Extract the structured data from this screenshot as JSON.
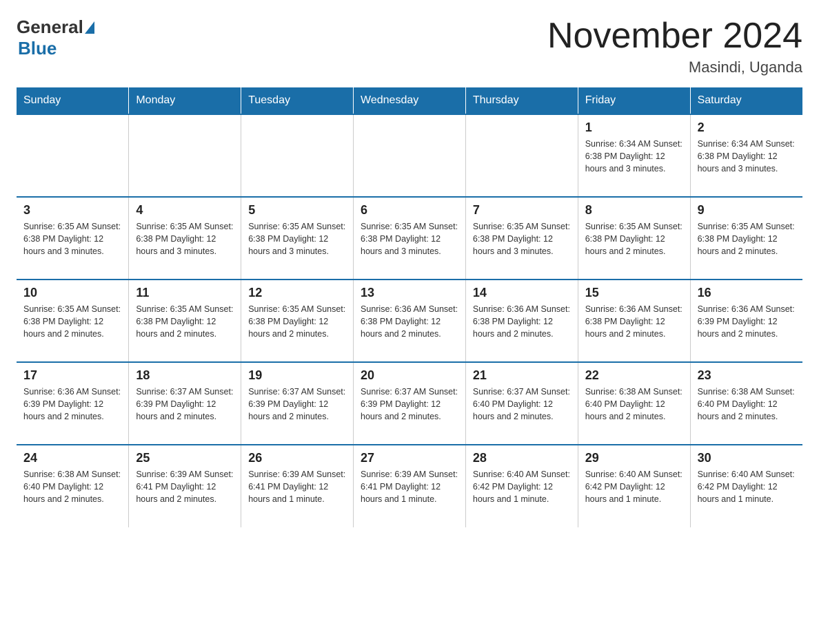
{
  "header": {
    "logo_general": "General",
    "logo_blue": "Blue",
    "title": "November 2024",
    "subtitle": "Masindi, Uganda"
  },
  "days_of_week": [
    "Sunday",
    "Monday",
    "Tuesday",
    "Wednesday",
    "Thursday",
    "Friday",
    "Saturday"
  ],
  "weeks": [
    [
      {
        "day": "",
        "info": ""
      },
      {
        "day": "",
        "info": ""
      },
      {
        "day": "",
        "info": ""
      },
      {
        "day": "",
        "info": ""
      },
      {
        "day": "",
        "info": ""
      },
      {
        "day": "1",
        "info": "Sunrise: 6:34 AM\nSunset: 6:38 PM\nDaylight: 12 hours and 3 minutes."
      },
      {
        "day": "2",
        "info": "Sunrise: 6:34 AM\nSunset: 6:38 PM\nDaylight: 12 hours and 3 minutes."
      }
    ],
    [
      {
        "day": "3",
        "info": "Sunrise: 6:35 AM\nSunset: 6:38 PM\nDaylight: 12 hours and 3 minutes."
      },
      {
        "day": "4",
        "info": "Sunrise: 6:35 AM\nSunset: 6:38 PM\nDaylight: 12 hours and 3 minutes."
      },
      {
        "day": "5",
        "info": "Sunrise: 6:35 AM\nSunset: 6:38 PM\nDaylight: 12 hours and 3 minutes."
      },
      {
        "day": "6",
        "info": "Sunrise: 6:35 AM\nSunset: 6:38 PM\nDaylight: 12 hours and 3 minutes."
      },
      {
        "day": "7",
        "info": "Sunrise: 6:35 AM\nSunset: 6:38 PM\nDaylight: 12 hours and 3 minutes."
      },
      {
        "day": "8",
        "info": "Sunrise: 6:35 AM\nSunset: 6:38 PM\nDaylight: 12 hours and 2 minutes."
      },
      {
        "day": "9",
        "info": "Sunrise: 6:35 AM\nSunset: 6:38 PM\nDaylight: 12 hours and 2 minutes."
      }
    ],
    [
      {
        "day": "10",
        "info": "Sunrise: 6:35 AM\nSunset: 6:38 PM\nDaylight: 12 hours and 2 minutes."
      },
      {
        "day": "11",
        "info": "Sunrise: 6:35 AM\nSunset: 6:38 PM\nDaylight: 12 hours and 2 minutes."
      },
      {
        "day": "12",
        "info": "Sunrise: 6:35 AM\nSunset: 6:38 PM\nDaylight: 12 hours and 2 minutes."
      },
      {
        "day": "13",
        "info": "Sunrise: 6:36 AM\nSunset: 6:38 PM\nDaylight: 12 hours and 2 minutes."
      },
      {
        "day": "14",
        "info": "Sunrise: 6:36 AM\nSunset: 6:38 PM\nDaylight: 12 hours and 2 minutes."
      },
      {
        "day": "15",
        "info": "Sunrise: 6:36 AM\nSunset: 6:38 PM\nDaylight: 12 hours and 2 minutes."
      },
      {
        "day": "16",
        "info": "Sunrise: 6:36 AM\nSunset: 6:39 PM\nDaylight: 12 hours and 2 minutes."
      }
    ],
    [
      {
        "day": "17",
        "info": "Sunrise: 6:36 AM\nSunset: 6:39 PM\nDaylight: 12 hours and 2 minutes."
      },
      {
        "day": "18",
        "info": "Sunrise: 6:37 AM\nSunset: 6:39 PM\nDaylight: 12 hours and 2 minutes."
      },
      {
        "day": "19",
        "info": "Sunrise: 6:37 AM\nSunset: 6:39 PM\nDaylight: 12 hours and 2 minutes."
      },
      {
        "day": "20",
        "info": "Sunrise: 6:37 AM\nSunset: 6:39 PM\nDaylight: 12 hours and 2 minutes."
      },
      {
        "day": "21",
        "info": "Sunrise: 6:37 AM\nSunset: 6:40 PM\nDaylight: 12 hours and 2 minutes."
      },
      {
        "day": "22",
        "info": "Sunrise: 6:38 AM\nSunset: 6:40 PM\nDaylight: 12 hours and 2 minutes."
      },
      {
        "day": "23",
        "info": "Sunrise: 6:38 AM\nSunset: 6:40 PM\nDaylight: 12 hours and 2 minutes."
      }
    ],
    [
      {
        "day": "24",
        "info": "Sunrise: 6:38 AM\nSunset: 6:40 PM\nDaylight: 12 hours and 2 minutes."
      },
      {
        "day": "25",
        "info": "Sunrise: 6:39 AM\nSunset: 6:41 PM\nDaylight: 12 hours and 2 minutes."
      },
      {
        "day": "26",
        "info": "Sunrise: 6:39 AM\nSunset: 6:41 PM\nDaylight: 12 hours and 1 minute."
      },
      {
        "day": "27",
        "info": "Sunrise: 6:39 AM\nSunset: 6:41 PM\nDaylight: 12 hours and 1 minute."
      },
      {
        "day": "28",
        "info": "Sunrise: 6:40 AM\nSunset: 6:42 PM\nDaylight: 12 hours and 1 minute."
      },
      {
        "day": "29",
        "info": "Sunrise: 6:40 AM\nSunset: 6:42 PM\nDaylight: 12 hours and 1 minute."
      },
      {
        "day": "30",
        "info": "Sunrise: 6:40 AM\nSunset: 6:42 PM\nDaylight: 12 hours and 1 minute."
      }
    ]
  ]
}
